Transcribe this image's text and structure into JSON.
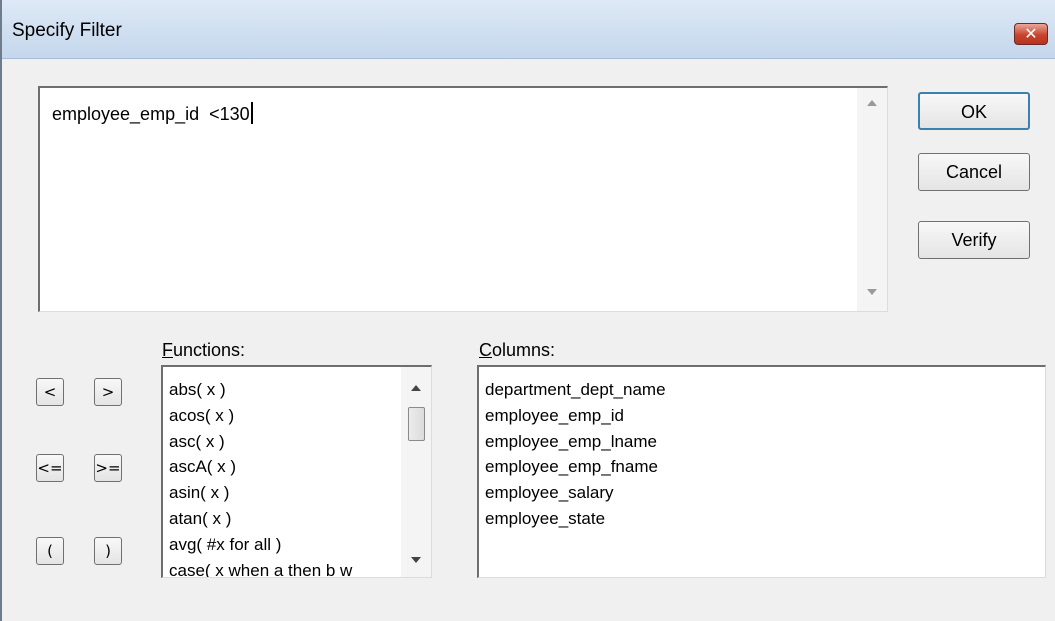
{
  "window": {
    "title": "Specify Filter",
    "close_glyph": "✕"
  },
  "filter": {
    "expression": "employee_emp_id  <130"
  },
  "buttons": {
    "ok": "OK",
    "cancel": "Cancel",
    "verify": "Verify"
  },
  "operators": {
    "lt": "<",
    "gt": ">",
    "le": "<=",
    "ge": ">=",
    "lparen": "(",
    "rparen": ")"
  },
  "functions": {
    "label_accel": "F",
    "label_rest": "unctions:",
    "items": [
      "abs( x )",
      "acos( x )",
      "asc( x )",
      "ascA( x )",
      "asin( x )",
      "atan( x )",
      "avg( #x for all )",
      "case( x when a then b w"
    ]
  },
  "columns": {
    "label_accel": "C",
    "label_rest": "olumns:",
    "items": [
      "department_dept_name",
      "employee_emp_id",
      "employee_emp_lname",
      "employee_emp_fname",
      "employee_salary",
      "employee_state"
    ]
  },
  "icons": {
    "close": "close-icon",
    "scroll_up": "chevron-up-icon",
    "scroll_down": "chevron-down-icon"
  },
  "colors": {
    "titlebar": "#c5d7ec",
    "close_button": "#c7442f",
    "default_button_border": "#3c7fb1",
    "dialog_bg": "#f0f0f0"
  }
}
